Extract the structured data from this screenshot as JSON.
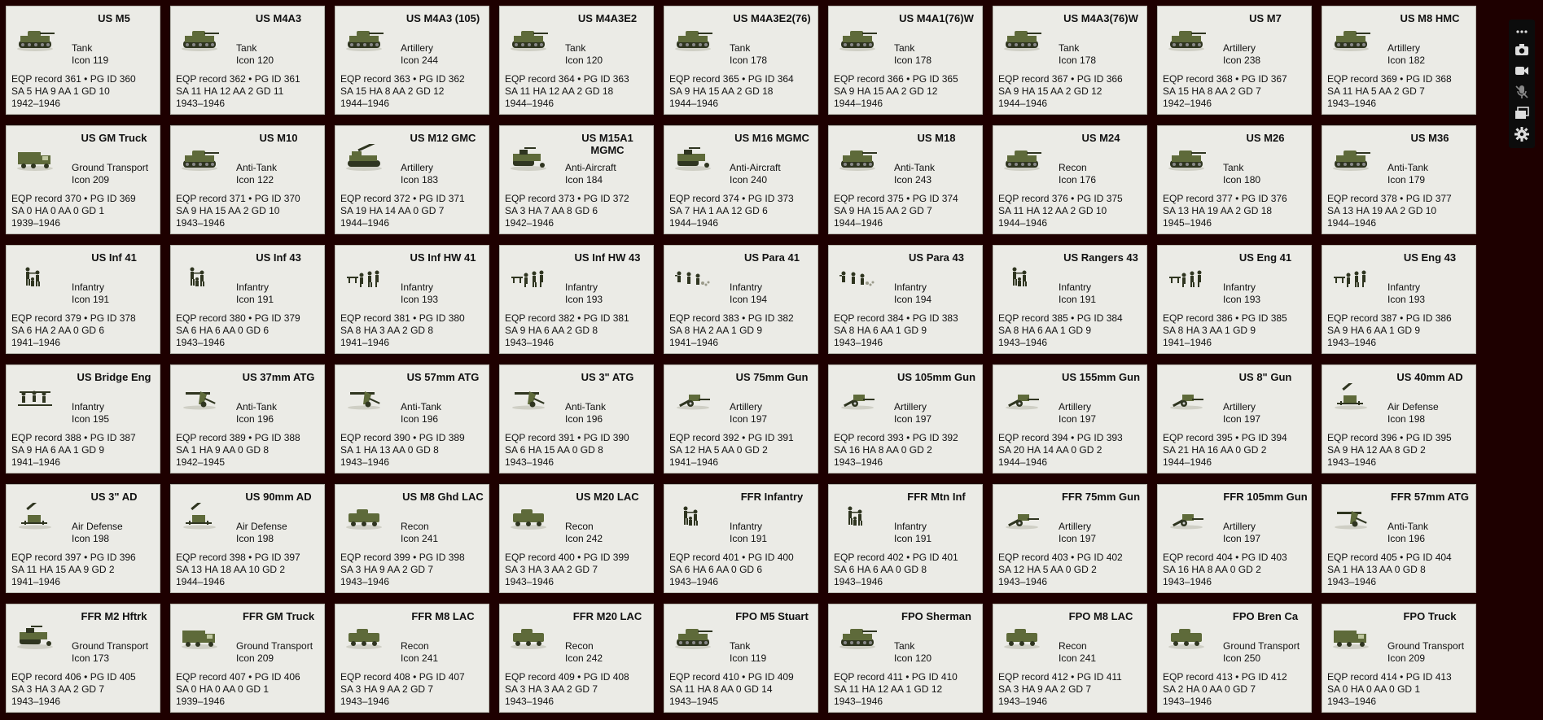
{
  "units": [
    {
      "name": "US M5",
      "type": "Tank",
      "icon": "Icon 119",
      "record": "EQP record 361 • PG ID 360",
      "stats": "SA 5  HA 9  AA 1  GD 10",
      "years": "1942–1946",
      "sprite": "tank"
    },
    {
      "name": "US M4A3",
      "type": "Tank",
      "icon": "Icon 120",
      "record": "EQP record 362 • PG ID 361",
      "stats": "SA 11  HA 12  AA 2  GD 11",
      "years": "1943–1946",
      "sprite": "tank"
    },
    {
      "name": "US M4A3 (105)",
      "type": "Artillery",
      "icon": "Icon 244",
      "record": "EQP record 363 • PG ID 362",
      "stats": "SA 15  HA 8  AA 2  GD 12",
      "years": "1944–1946",
      "sprite": "tank"
    },
    {
      "name": "US M4A3E2",
      "type": "Tank",
      "icon": "Icon 120",
      "record": "EQP record 364 • PG ID 363",
      "stats": "SA 11  HA 12  AA 2  GD 18",
      "years": "1944–1946",
      "sprite": "tank"
    },
    {
      "name": "US M4A3E2(76)",
      "type": "Tank",
      "icon": "Icon 178",
      "record": "EQP record 365 • PG ID 364",
      "stats": "SA 9  HA 15  AA 2  GD 18",
      "years": "1944–1946",
      "sprite": "tank"
    },
    {
      "name": "US M4A1(76)W",
      "type": "Tank",
      "icon": "Icon 178",
      "record": "EQP record 366 • PG ID 365",
      "stats": "SA 9  HA 15  AA 2  GD 12",
      "years": "1944–1946",
      "sprite": "tank"
    },
    {
      "name": "US M4A3(76)W",
      "type": "Tank",
      "icon": "Icon 178",
      "record": "EQP record 367 • PG ID 366",
      "stats": "SA 9  HA 15  AA 2  GD 12",
      "years": "1944–1946",
      "sprite": "tank"
    },
    {
      "name": "US M7",
      "type": "Artillery",
      "icon": "Icon 238",
      "record": "EQP record 368 • PG ID 367",
      "stats": "SA 15  HA 8  AA 2  GD 7",
      "years": "1942–1946",
      "sprite": "tank"
    },
    {
      "name": "US M8 HMC",
      "type": "Artillery",
      "icon": "Icon 182",
      "record": "EQP record 369 • PG ID 368",
      "stats": "SA 11  HA 5  AA 2  GD 7",
      "years": "1943–1946",
      "sprite": "tank"
    },
    {
      "name": "US GM Truck",
      "type": "Ground Transport",
      "icon": "Icon 209",
      "record": "EQP record 370 • PG ID 369",
      "stats": "SA 0  HA 0  AA 0  GD 1",
      "years": "1939–1946",
      "sprite": "truck"
    },
    {
      "name": "US M10",
      "type": "Anti-Tank",
      "icon": "Icon 122",
      "record": "EQP record 371 • PG ID 370",
      "stats": "SA 9  HA 15  AA 2  GD 10",
      "years": "1943–1946",
      "sprite": "tank"
    },
    {
      "name": "US M12 GMC",
      "type": "Artillery",
      "icon": "Icon 183",
      "record": "EQP record 372 • PG ID 371",
      "stats": "SA 19  HA 14  AA 0  GD 7",
      "years": "1944–1946",
      "sprite": "spg"
    },
    {
      "name": "US M15A1 MGMC",
      "type": "Anti-Aircraft",
      "icon": "Icon 184",
      "record": "EQP record 373 • PG ID 372",
      "stats": "SA 3  HA 7  AA 8  GD 6",
      "years": "1942–1946",
      "sprite": "halftrack"
    },
    {
      "name": "US M16 MGMC",
      "type": "Anti-Aircraft",
      "icon": "Icon 240",
      "record": "EQP record 374 • PG ID 373",
      "stats": "SA 7  HA 1  AA 12  GD 6",
      "years": "1944–1946",
      "sprite": "halftrack"
    },
    {
      "name": "US M18",
      "type": "Anti-Tank",
      "icon": "Icon 243",
      "record": "EQP record 375 • PG ID 374",
      "stats": "SA 9  HA 15  AA 2  GD 7",
      "years": "1944–1946",
      "sprite": "tank"
    },
    {
      "name": "US M24",
      "type": "Recon",
      "icon": "Icon 176",
      "record": "EQP record 376 • PG ID 375",
      "stats": "SA 11  HA 12  AA 2  GD 10",
      "years": "1944–1946",
      "sprite": "tank"
    },
    {
      "name": "US M26",
      "type": "Tank",
      "icon": "Icon 180",
      "record": "EQP record 377 • PG ID 376",
      "stats": "SA 13  HA 19  AA 2  GD 18",
      "years": "1945–1946",
      "sprite": "tank"
    },
    {
      "name": "US M36",
      "type": "Anti-Tank",
      "icon": "Icon 179",
      "record": "EQP record 378 • PG ID 377",
      "stats": "SA 13  HA 19  AA 2  GD 10",
      "years": "1944–1946",
      "sprite": "tank"
    },
    {
      "name": "US Inf 41",
      "type": "Infantry",
      "icon": "Icon 191",
      "record": "EQP record 379 • PG ID 378",
      "stats": "SA 6  HA 2  AA 0  GD 6",
      "years": "1941–1946",
      "sprite": "inf"
    },
    {
      "name": "US Inf 43",
      "type": "Infantry",
      "icon": "Icon 191",
      "record": "EQP record 380 • PG ID 379",
      "stats": "SA 6  HA 6  AA 0  GD 6",
      "years": "1943–1946",
      "sprite": "inf"
    },
    {
      "name": "US Inf HW 41",
      "type": "Infantry",
      "icon": "Icon 193",
      "record": "EQP record 381 • PG ID 380",
      "stats": "SA 8  HA 3  AA 2  GD 8",
      "years": "1941–1946",
      "sprite": "infhw"
    },
    {
      "name": "US Inf HW 43",
      "type": "Infantry",
      "icon": "Icon 193",
      "record": "EQP record 382 • PG ID 381",
      "stats": "SA 9  HA 6  AA 2  GD 8",
      "years": "1943–1946",
      "sprite": "infhw"
    },
    {
      "name": "US Para 41",
      "type": "Infantry",
      "icon": "Icon 194",
      "record": "EQP record 383 • PG ID 382",
      "stats": "SA 8  HA 2  AA 1  GD 9",
      "years": "1941–1946",
      "sprite": "para"
    },
    {
      "name": "US Para 43",
      "type": "Infantry",
      "icon": "Icon 194",
      "record": "EQP record 384 • PG ID 383",
      "stats": "SA 8  HA 6  AA 1  GD 9",
      "years": "1943–1946",
      "sprite": "para"
    },
    {
      "name": "US Rangers 43",
      "type": "Infantry",
      "icon": "Icon 191",
      "record": "EQP record 385 • PG ID 384",
      "stats": "SA 8  HA 6  AA 1  GD 9",
      "years": "1943–1946",
      "sprite": "inf"
    },
    {
      "name": "US Eng 41",
      "type": "Infantry",
      "icon": "Icon 193",
      "record": "EQP record 386 • PG ID 385",
      "stats": "SA 8  HA 3  AA 1  GD 9",
      "years": "1941–1946",
      "sprite": "infhw"
    },
    {
      "name": "US Eng 43",
      "type": "Infantry",
      "icon": "Icon 193",
      "record": "EQP record 387 • PG ID 386",
      "stats": "SA 9  HA 6  AA 1  GD 9",
      "years": "1943–1946",
      "sprite": "infhw"
    },
    {
      "name": "US Bridge Eng",
      "type": "Infantry",
      "icon": "Icon 195",
      "record": "EQP record 388 • PG ID 387",
      "stats": "SA 9  HA 6  AA 1  GD 9",
      "years": "1941–1946",
      "sprite": "bridge"
    },
    {
      "name": "US 37mm ATG",
      "type": "Anti-Tank",
      "icon": "Icon 196",
      "record": "EQP record 389 • PG ID 388",
      "stats": "SA 1  HA 9  AA 0  GD 8",
      "years": "1942–1945",
      "sprite": "atg"
    },
    {
      "name": "US 57mm ATG",
      "type": "Anti-Tank",
      "icon": "Icon 196",
      "record": "EQP record 390 • PG ID 389",
      "stats": "SA 1  HA 13  AA 0  GD 8",
      "years": "1943–1946",
      "sprite": "atg"
    },
    {
      "name": "US 3\" ATG",
      "type": "Anti-Tank",
      "icon": "Icon 196",
      "record": "EQP record 391 • PG ID 390",
      "stats": "SA 6  HA 15  AA 0  GD 8",
      "years": "1943–1946",
      "sprite": "atg"
    },
    {
      "name": "US 75mm Gun",
      "type": "Artillery",
      "icon": "Icon 197",
      "record": "EQP record 392 • PG ID 391",
      "stats": "SA 12  HA 5  AA 0  GD 2",
      "years": "1941–1946",
      "sprite": "gun"
    },
    {
      "name": "US 105mm Gun",
      "type": "Artillery",
      "icon": "Icon 197",
      "record": "EQP record 393 • PG ID 392",
      "stats": "SA 16  HA 8  AA 0  GD 2",
      "years": "1943–1946",
      "sprite": "gun"
    },
    {
      "name": "US 155mm Gun",
      "type": "Artillery",
      "icon": "Icon 197",
      "record": "EQP record 394 • PG ID 393",
      "stats": "SA 20  HA 14  AA 0  GD 2",
      "years": "1944–1946",
      "sprite": "gun"
    },
    {
      "name": "US 8\" Gun",
      "type": "Artillery",
      "icon": "Icon 197",
      "record": "EQP record 395 • PG ID 394",
      "stats": "SA 21  HA 16  AA 0  GD 2",
      "years": "1944–1946",
      "sprite": "gun"
    },
    {
      "name": "US 40mm AD",
      "type": "Air Defense",
      "icon": "Icon 198",
      "record": "EQP record 396 • PG ID 395",
      "stats": "SA 9  HA 12  AA 8  GD 2",
      "years": "1943–1946",
      "sprite": "ad"
    },
    {
      "name": "US 3\" AD",
      "type": "Air Defense",
      "icon": "Icon 198",
      "record": "EQP record 397 • PG ID 396",
      "stats": "SA 11  HA 15  AA 9  GD 2",
      "years": "1941–1946",
      "sprite": "ad"
    },
    {
      "name": "US 90mm AD",
      "type": "Air Defense",
      "icon": "Icon 198",
      "record": "EQP record 398 • PG ID 397",
      "stats": "SA 13  HA 18  AA 10  GD 2",
      "years": "1944–1946",
      "sprite": "ad"
    },
    {
      "name": "US M8 Ghd LAC",
      "type": "Recon",
      "icon": "Icon 241",
      "record": "EQP record 399 • PG ID 398",
      "stats": "SA 3  HA 9  AA 2  GD 7",
      "years": "1943–1946",
      "sprite": "armcar"
    },
    {
      "name": "US M20 LAC",
      "type": "Recon",
      "icon": "Icon 242",
      "record": "EQP record 400 • PG ID 399",
      "stats": "SA 3  HA 3  AA 2  GD 7",
      "years": "1943–1946",
      "sprite": "armcar"
    },
    {
      "name": "FFR Infantry",
      "type": "Infantry",
      "icon": "Icon 191",
      "record": "EQP record 401 • PG ID 400",
      "stats": "SA 6  HA 6  AA 0  GD 6",
      "years": "1943–1946",
      "sprite": "inf"
    },
    {
      "name": "FFR Mtn Inf",
      "type": "Infantry",
      "icon": "Icon 191",
      "record": "EQP record 402 • PG ID 401",
      "stats": "SA 6  HA 6  AA 0  GD 8",
      "years": "1943–1946",
      "sprite": "inf"
    },
    {
      "name": "FFR 75mm Gun",
      "type": "Artillery",
      "icon": "Icon 197",
      "record": "EQP record 403 • PG ID 402",
      "stats": "SA 12  HA 5  AA 0  GD 2",
      "years": "1943–1946",
      "sprite": "gun"
    },
    {
      "name": "FFR 105mm Gun",
      "type": "Artillery",
      "icon": "Icon 197",
      "record": "EQP record 404 • PG ID 403",
      "stats": "SA 16  HA 8  AA 0  GD 2",
      "years": "1943–1946",
      "sprite": "gun"
    },
    {
      "name": "FFR 57mm ATG",
      "type": "Anti-Tank",
      "icon": "Icon 196",
      "record": "EQP record 405 • PG ID 404",
      "stats": "SA 1  HA 13  AA 0  GD 8",
      "years": "1943–1946",
      "sprite": "atg"
    },
    {
      "name": "FFR M2 Hftrk",
      "type": "Ground Transport",
      "icon": "Icon 173",
      "record": "EQP record 406 • PG ID 405",
      "stats": "SA 3  HA 3  AA 2  GD 7",
      "years": "1943–1946",
      "sprite": "halftrack"
    },
    {
      "name": "FFR GM Truck",
      "type": "Ground Transport",
      "icon": "Icon 209",
      "record": "EQP record 407 • PG ID 406",
      "stats": "SA 0  HA 0  AA 0  GD 1",
      "years": "1939–1946",
      "sprite": "truck"
    },
    {
      "name": "FFR M8 LAC",
      "type": "Recon",
      "icon": "Icon 241",
      "record": "EQP record 408 • PG ID 407",
      "stats": "SA 3  HA 9  AA 2  GD 7",
      "years": "1943–1946",
      "sprite": "armcar"
    },
    {
      "name": "FFR M20 LAC",
      "type": "Recon",
      "icon": "Icon 242",
      "record": "EQP record 409 • PG ID 408",
      "stats": "SA 3  HA 3  AA 2  GD 7",
      "years": "1943–1946",
      "sprite": "armcar"
    },
    {
      "name": "FPO M5 Stuart",
      "type": "Tank",
      "icon": "Icon 119",
      "record": "EQP record 410 • PG ID 409",
      "stats": "SA 11  HA 8  AA 0  GD 14",
      "years": "1943–1945",
      "sprite": "tank"
    },
    {
      "name": "FPO Sherman",
      "type": "Tank",
      "icon": "Icon 120",
      "record": "EQP record 411 • PG ID 410",
      "stats": "SA 11  HA 12  AA 1  GD 12",
      "years": "1943–1946",
      "sprite": "tank"
    },
    {
      "name": "FPO M8 LAC",
      "type": "Recon",
      "icon": "Icon 241",
      "record": "EQP record 412 • PG ID 411",
      "stats": "SA 3  HA 9  AA 2  GD 7",
      "years": "1943–1946",
      "sprite": "armcar"
    },
    {
      "name": "FPO Bren Ca",
      "type": "Ground Transport",
      "icon": "Icon 250",
      "record": "EQP record 413 • PG ID 412",
      "stats": "SA 2  HA 0  AA 0  GD 7",
      "years": "1943–1946",
      "sprite": "armcar"
    },
    {
      "name": "FPO Truck",
      "type": "Ground Transport",
      "icon": "Icon 209",
      "record": "EQP record 414 • PG ID 413",
      "stats": "SA 0  HA 0  AA 0  GD 1",
      "years": "1943–1946",
      "sprite": "truck"
    }
  ],
  "toolbar": [
    {
      "name": "more-options-icon",
      "glyph": "more"
    },
    {
      "name": "camera-icon",
      "glyph": "camera"
    },
    {
      "name": "video-icon",
      "glyph": "video"
    },
    {
      "name": "mic-off-icon",
      "glyph": "micoff"
    },
    {
      "name": "windows-icon",
      "glyph": "windows"
    },
    {
      "name": "settings-gear-icon",
      "glyph": "gear"
    }
  ],
  "colors": {
    "background": "#1e0000",
    "card": "#ebebe6",
    "sprite_body": "#5e6a3a",
    "sprite_dark": "#2f3520"
  }
}
